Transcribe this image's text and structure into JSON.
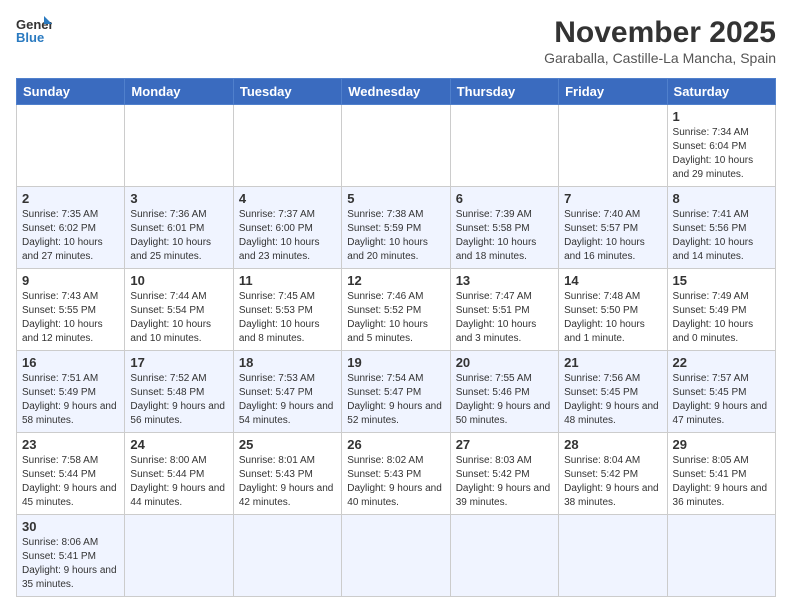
{
  "header": {
    "logo_general": "General",
    "logo_blue": "Blue",
    "month_title": "November 2025",
    "location": "Garaballa, Castille-La Mancha, Spain"
  },
  "weekdays": [
    "Sunday",
    "Monday",
    "Tuesday",
    "Wednesday",
    "Thursday",
    "Friday",
    "Saturday"
  ],
  "weeks": [
    [
      {
        "day": "",
        "info": ""
      },
      {
        "day": "",
        "info": ""
      },
      {
        "day": "",
        "info": ""
      },
      {
        "day": "",
        "info": ""
      },
      {
        "day": "",
        "info": ""
      },
      {
        "day": "",
        "info": ""
      },
      {
        "day": "1",
        "info": "Sunrise: 7:34 AM\nSunset: 6:04 PM\nDaylight: 10 hours and 29 minutes."
      }
    ],
    [
      {
        "day": "2",
        "info": "Sunrise: 7:35 AM\nSunset: 6:02 PM\nDaylight: 10 hours and 27 minutes."
      },
      {
        "day": "3",
        "info": "Sunrise: 7:36 AM\nSunset: 6:01 PM\nDaylight: 10 hours and 25 minutes."
      },
      {
        "day": "4",
        "info": "Sunrise: 7:37 AM\nSunset: 6:00 PM\nDaylight: 10 hours and 23 minutes."
      },
      {
        "day": "5",
        "info": "Sunrise: 7:38 AM\nSunset: 5:59 PM\nDaylight: 10 hours and 20 minutes."
      },
      {
        "day": "6",
        "info": "Sunrise: 7:39 AM\nSunset: 5:58 PM\nDaylight: 10 hours and 18 minutes."
      },
      {
        "day": "7",
        "info": "Sunrise: 7:40 AM\nSunset: 5:57 PM\nDaylight: 10 hours and 16 minutes."
      },
      {
        "day": "8",
        "info": "Sunrise: 7:41 AM\nSunset: 5:56 PM\nDaylight: 10 hours and 14 minutes."
      }
    ],
    [
      {
        "day": "9",
        "info": "Sunrise: 7:43 AM\nSunset: 5:55 PM\nDaylight: 10 hours and 12 minutes."
      },
      {
        "day": "10",
        "info": "Sunrise: 7:44 AM\nSunset: 5:54 PM\nDaylight: 10 hours and 10 minutes."
      },
      {
        "day": "11",
        "info": "Sunrise: 7:45 AM\nSunset: 5:53 PM\nDaylight: 10 hours and 8 minutes."
      },
      {
        "day": "12",
        "info": "Sunrise: 7:46 AM\nSunset: 5:52 PM\nDaylight: 10 hours and 5 minutes."
      },
      {
        "day": "13",
        "info": "Sunrise: 7:47 AM\nSunset: 5:51 PM\nDaylight: 10 hours and 3 minutes."
      },
      {
        "day": "14",
        "info": "Sunrise: 7:48 AM\nSunset: 5:50 PM\nDaylight: 10 hours and 1 minute."
      },
      {
        "day": "15",
        "info": "Sunrise: 7:49 AM\nSunset: 5:49 PM\nDaylight: 10 hours and 0 minutes."
      }
    ],
    [
      {
        "day": "16",
        "info": "Sunrise: 7:51 AM\nSunset: 5:49 PM\nDaylight: 9 hours and 58 minutes."
      },
      {
        "day": "17",
        "info": "Sunrise: 7:52 AM\nSunset: 5:48 PM\nDaylight: 9 hours and 56 minutes."
      },
      {
        "day": "18",
        "info": "Sunrise: 7:53 AM\nSunset: 5:47 PM\nDaylight: 9 hours and 54 minutes."
      },
      {
        "day": "19",
        "info": "Sunrise: 7:54 AM\nSunset: 5:47 PM\nDaylight: 9 hours and 52 minutes."
      },
      {
        "day": "20",
        "info": "Sunrise: 7:55 AM\nSunset: 5:46 PM\nDaylight: 9 hours and 50 minutes."
      },
      {
        "day": "21",
        "info": "Sunrise: 7:56 AM\nSunset: 5:45 PM\nDaylight: 9 hours and 48 minutes."
      },
      {
        "day": "22",
        "info": "Sunrise: 7:57 AM\nSunset: 5:45 PM\nDaylight: 9 hours and 47 minutes."
      }
    ],
    [
      {
        "day": "23",
        "info": "Sunrise: 7:58 AM\nSunset: 5:44 PM\nDaylight: 9 hours and 45 minutes."
      },
      {
        "day": "24",
        "info": "Sunrise: 8:00 AM\nSunset: 5:44 PM\nDaylight: 9 hours and 44 minutes."
      },
      {
        "day": "25",
        "info": "Sunrise: 8:01 AM\nSunset: 5:43 PM\nDaylight: 9 hours and 42 minutes."
      },
      {
        "day": "26",
        "info": "Sunrise: 8:02 AM\nSunset: 5:43 PM\nDaylight: 9 hours and 40 minutes."
      },
      {
        "day": "27",
        "info": "Sunrise: 8:03 AM\nSunset: 5:42 PM\nDaylight: 9 hours and 39 minutes."
      },
      {
        "day": "28",
        "info": "Sunrise: 8:04 AM\nSunset: 5:42 PM\nDaylight: 9 hours and 38 minutes."
      },
      {
        "day": "29",
        "info": "Sunrise: 8:05 AM\nSunset: 5:41 PM\nDaylight: 9 hours and 36 minutes."
      }
    ],
    [
      {
        "day": "30",
        "info": "Sunrise: 8:06 AM\nSunset: 5:41 PM\nDaylight: 9 hours and 35 minutes."
      },
      {
        "day": "",
        "info": ""
      },
      {
        "day": "",
        "info": ""
      },
      {
        "day": "",
        "info": ""
      },
      {
        "day": "",
        "info": ""
      },
      {
        "day": "",
        "info": ""
      },
      {
        "day": "",
        "info": ""
      }
    ]
  ]
}
